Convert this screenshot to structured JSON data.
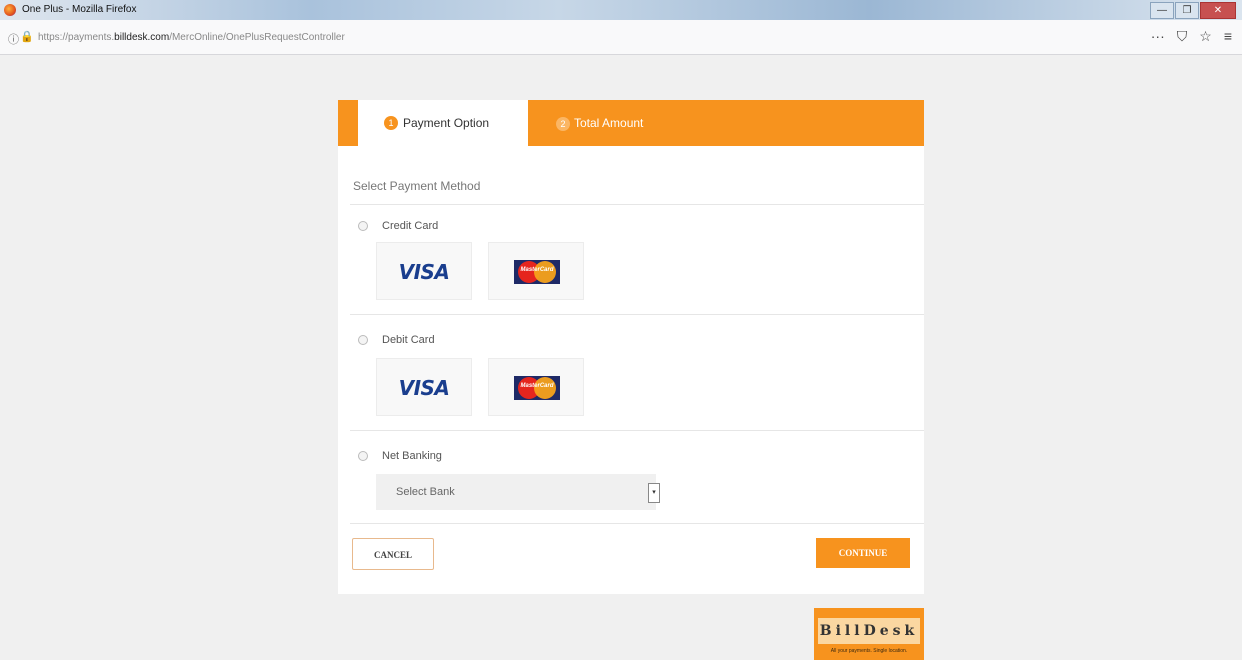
{
  "window": {
    "title": "One Plus - Mozilla Firefox",
    "minimize": "—",
    "maximize": "❐",
    "close": "✕"
  },
  "browser": {
    "url_prefix": "https://payments.",
    "url_domain": "billdesk.com",
    "url_path": "/MercOnline/OnePlusRequestController",
    "tools": [
      "···",
      "⛉",
      "☆",
      "≡"
    ]
  },
  "tabs": [
    {
      "num": "1",
      "label": "Payment Option"
    },
    {
      "num": "2",
      "label": "Total Amount"
    }
  ],
  "heading": "Select Payment Method",
  "options": {
    "credit": {
      "label": "Credit Card"
    },
    "debit": {
      "label": "Debit Card"
    },
    "netbanking": {
      "label": "Net Banking"
    }
  },
  "card_logos": {
    "visa": "VISA",
    "mastercard": "MasterCard"
  },
  "bank_select": {
    "value": "Select Bank",
    "arrow": "▾"
  },
  "buttons": {
    "cancel": "CANCEL",
    "continue": "CONTINUE"
  },
  "brand": {
    "name": "BillDesk",
    "tagline": "All your payments. Single location."
  },
  "colors": {
    "accent": "#f7931e",
    "visa_blue": "#1a3e8e"
  }
}
